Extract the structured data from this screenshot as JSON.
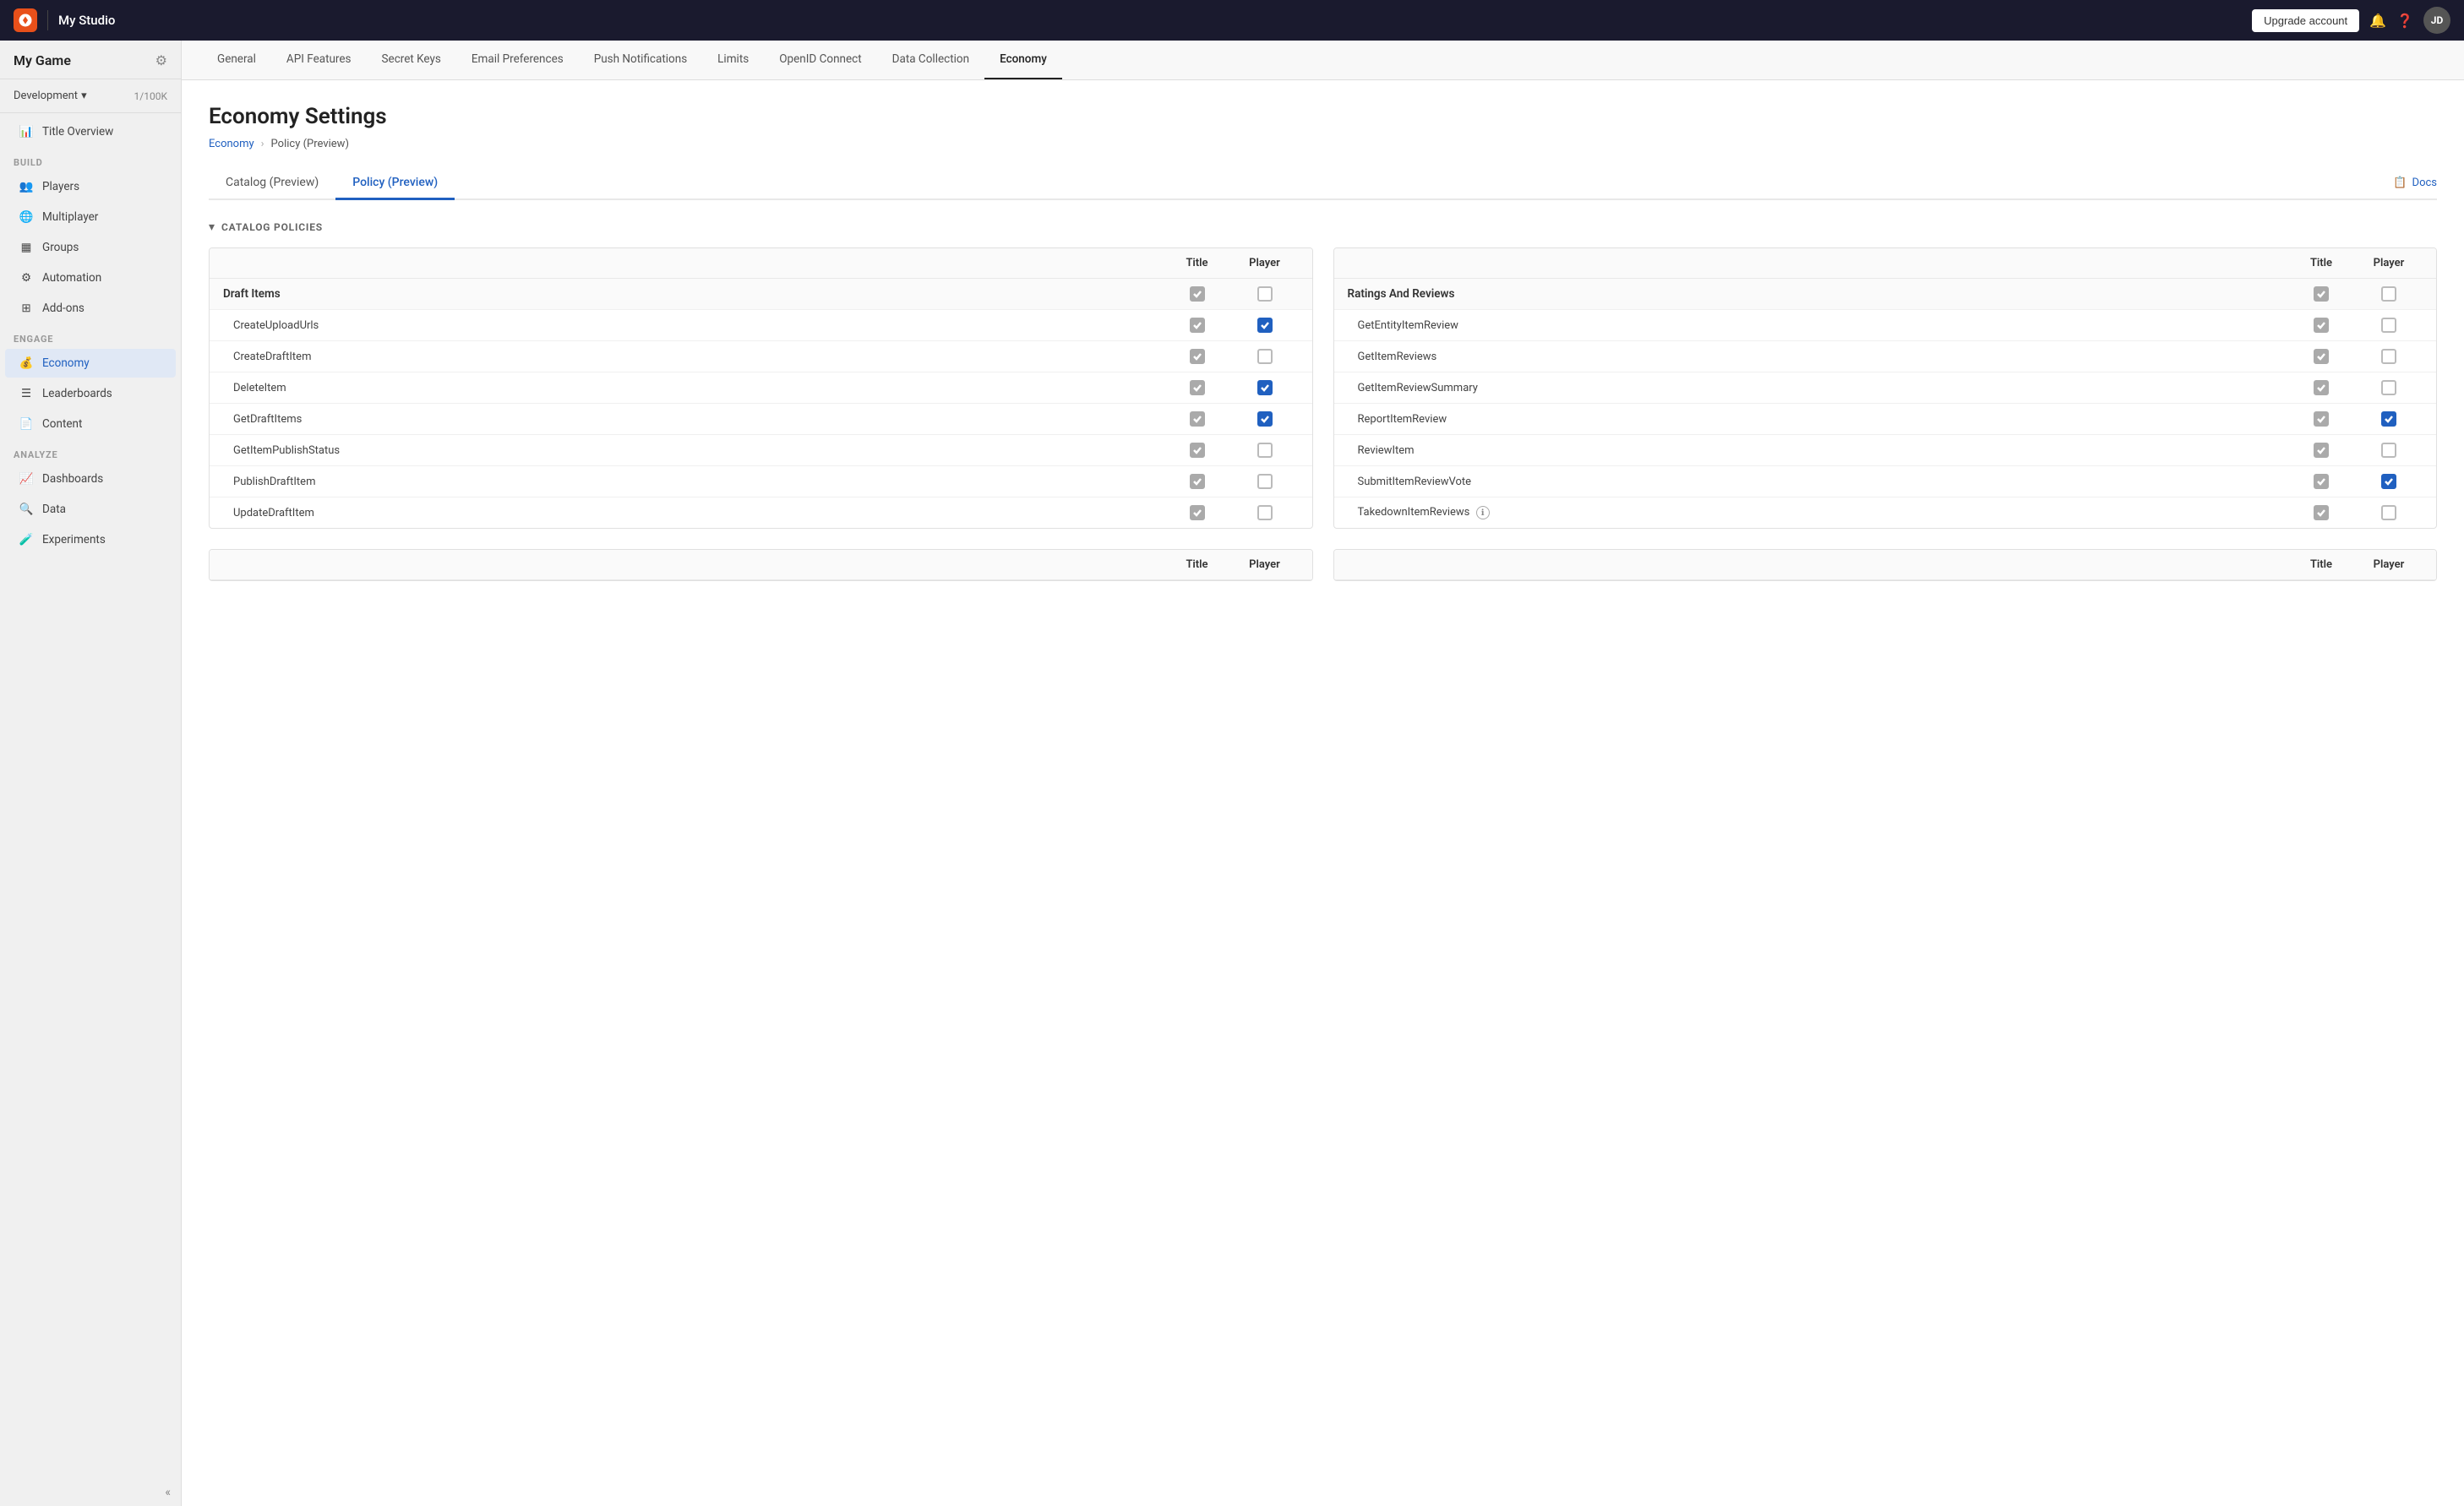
{
  "topbar": {
    "logo_alt": "Unity",
    "title": "My Studio",
    "upgrade_label": "Upgrade account",
    "avatar_initials": "JD"
  },
  "sidebar": {
    "game_name": "My Game",
    "environment": "Development",
    "env_count": "1/100K",
    "title_overview_label": "Title Overview",
    "build_section": "BUILD",
    "build_items": [
      {
        "label": "Players",
        "icon": "users"
      },
      {
        "label": "Multiplayer",
        "icon": "globe"
      },
      {
        "label": "Groups",
        "icon": "layers"
      },
      {
        "label": "Automation",
        "icon": "settings"
      },
      {
        "label": "Add-ons",
        "icon": "grid"
      }
    ],
    "engage_section": "ENGAGE",
    "engage_items": [
      {
        "label": "Economy",
        "icon": "economy",
        "active": true
      },
      {
        "label": "Leaderboards",
        "icon": "leaderboard"
      },
      {
        "label": "Content",
        "icon": "content"
      }
    ],
    "analyze_section": "ANALYZE",
    "analyze_items": [
      {
        "label": "Dashboards",
        "icon": "dashboard"
      },
      {
        "label": "Data",
        "icon": "data"
      },
      {
        "label": "Experiments",
        "icon": "experiments"
      }
    ]
  },
  "nav_tabs": [
    {
      "label": "General"
    },
    {
      "label": "API Features"
    },
    {
      "label": "Secret Keys"
    },
    {
      "label": "Email Preferences"
    },
    {
      "label": "Push Notifications"
    },
    {
      "label": "Limits"
    },
    {
      "label": "OpenID Connect"
    },
    {
      "label": "Data Collection"
    },
    {
      "label": "Economy",
      "active": true
    }
  ],
  "page": {
    "title": "Economy Settings",
    "breadcrumb_link": "Economy",
    "breadcrumb_current": "Policy (Preview)",
    "sub_tabs": [
      {
        "label": "Catalog (Preview)"
      },
      {
        "label": "Policy (Preview)",
        "active": true
      }
    ],
    "docs_label": "Docs",
    "section_title": "CATALOG POLICIES",
    "left_table": {
      "headers": [
        "",
        "Title",
        "Player"
      ],
      "parent": "Draft Items",
      "rows": [
        {
          "name": "CreateUploadUrls",
          "title_checked": "gray",
          "player_checked": "blue"
        },
        {
          "name": "CreateDraftItem",
          "title_checked": "gray",
          "player_checked": "unchecked"
        },
        {
          "name": "DeleteItem",
          "title_checked": "gray",
          "player_checked": "blue"
        },
        {
          "name": "GetDraftItems",
          "title_checked": "gray",
          "player_checked": "blue"
        },
        {
          "name": "GetItemPublishStatus",
          "title_checked": "gray",
          "player_checked": "unchecked"
        },
        {
          "name": "PublishDraftItem",
          "title_checked": "gray",
          "player_checked": "unchecked"
        },
        {
          "name": "UpdateDraftItem",
          "title_checked": "gray",
          "player_checked": "unchecked"
        }
      ]
    },
    "right_table": {
      "headers": [
        "",
        "Title",
        "Player"
      ],
      "parent": "Ratings And Reviews",
      "rows": [
        {
          "name": "GetEntityItemReview",
          "title_checked": "gray",
          "player_checked": "unchecked"
        },
        {
          "name": "GetItemReviews",
          "title_checked": "gray",
          "player_checked": "unchecked"
        },
        {
          "name": "GetItemReviewSummary",
          "title_checked": "gray",
          "player_checked": "unchecked"
        },
        {
          "name": "ReportItemReview",
          "title_checked": "gray",
          "player_checked": "blue"
        },
        {
          "name": "ReviewItem",
          "title_checked": "gray",
          "player_checked": "unchecked"
        },
        {
          "name": "SubmitItemReviewVote",
          "title_checked": "gray",
          "player_checked": "blue"
        },
        {
          "name": "TakedownItemReviews",
          "title_checked": "gray",
          "player_checked": "unchecked",
          "has_info": true
        }
      ]
    },
    "bottom_table_headers": [
      "",
      "Title",
      "Player"
    ]
  }
}
